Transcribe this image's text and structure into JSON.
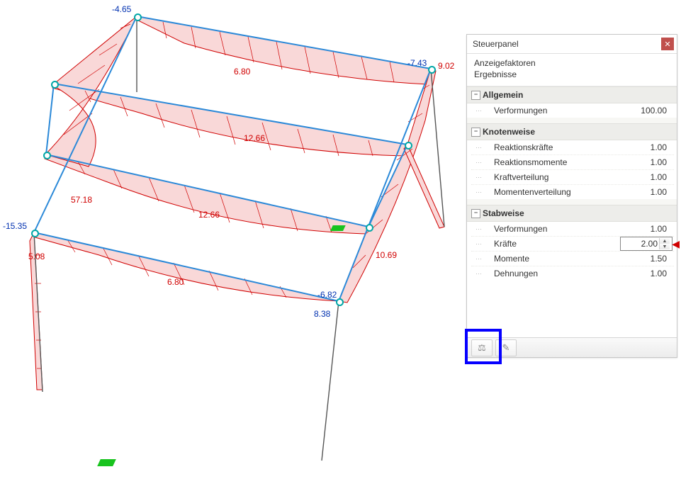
{
  "panel": {
    "title": "Steuerpanel",
    "head_line1": "Anzeigefaktoren",
    "head_line2": "Ergebnisse",
    "groups": {
      "allgemein": {
        "label": "Allgemein",
        "rows": {
          "verformungen": {
            "label": "Verformungen",
            "value": "100.00"
          }
        }
      },
      "knotenweise": {
        "label": "Knotenweise",
        "rows": {
          "reaktionskraefte": {
            "label": "Reaktionskräfte",
            "value": "1.00"
          },
          "reaktionsmomente": {
            "label": "Reaktionsmomente",
            "value": "1.00"
          },
          "kraftverteilung": {
            "label": "Kraftverteilung",
            "value": "1.00"
          },
          "momentenverteilung": {
            "label": "Momentenverteilung",
            "value": "1.00"
          }
        }
      },
      "stabweise": {
        "label": "Stabweise",
        "rows": {
          "verformungen": {
            "label": "Verformungen",
            "value": "1.00"
          },
          "kraefte": {
            "label": "Kräfte",
            "value": "2.00"
          },
          "momente": {
            "label": "Momente",
            "value": "1.50"
          },
          "dehnungen": {
            "label": "Dehnungen",
            "value": "1.00"
          }
        }
      }
    }
  },
  "viewport_labels": {
    "n_465": "-4.65",
    "n_680a": "6.80",
    "n_743": "-7.43",
    "n_902": "9.02",
    "n_1266a": "12.66",
    "n_5718": "57.18",
    "n_1535": "-15.35",
    "n_1266b": "12.66",
    "n_508": "5.08",
    "n_680b": "6.80",
    "n_1069": "10.69",
    "n_682": "-6.82",
    "n_838": "8.38"
  },
  "colors": {
    "diagram_fill": "#f9d8d8",
    "diagram_stroke": "#d00000",
    "member_stroke": "#2b89d8",
    "node_ring": "#00a6a6",
    "support_green": "#18c31e"
  },
  "icons": {
    "expander": "−",
    "close_x": "✕",
    "balance": "⚖",
    "wand": "✎",
    "arrow_left": "◀",
    "spin_up": "▲",
    "spin_down": "▼"
  }
}
